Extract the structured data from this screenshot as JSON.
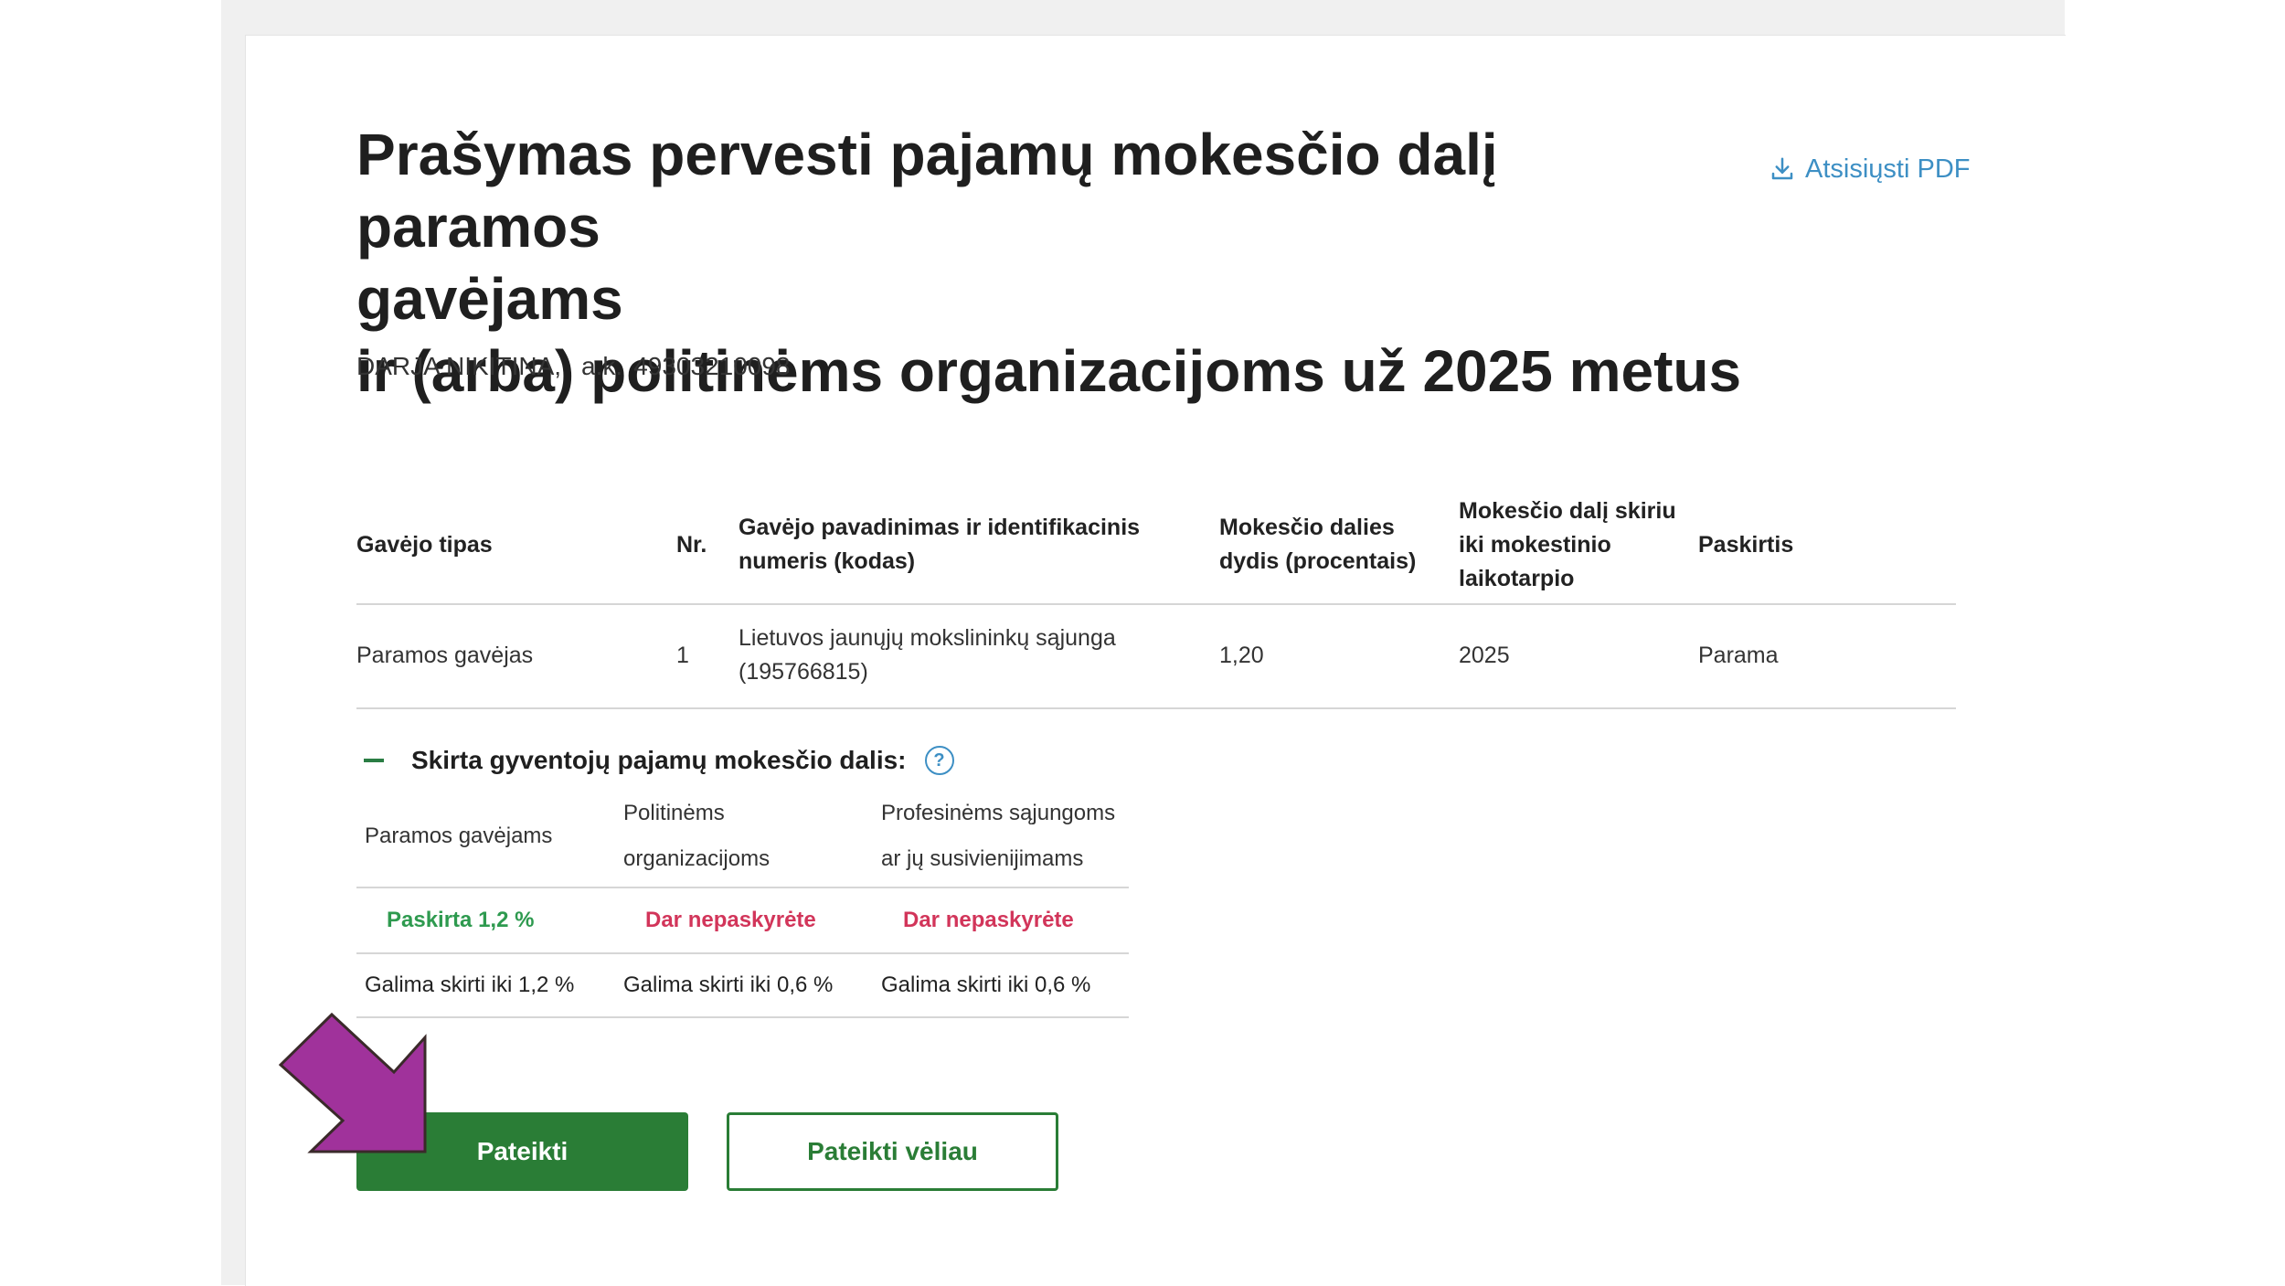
{
  "header": {
    "title_line1": "Prašymas pervesti pajamų mokesčio dalį paramos",
    "title_line2": "gavėjams",
    "title_line3": "ir (arba) politinėms organizacijoms už 2025 metus",
    "pdf_label": "Atsisiųsti PDF",
    "pdf_icon": "download-icon",
    "person_name": "DARJA NIKITINA,",
    "person_code_label": "a.k.",
    "person_code": "49303210098"
  },
  "table": {
    "columns": [
      "Gavėjo tipas",
      "Nr.",
      "Gavėjo pavadinimas ir identifikacinis numeris (kodas)",
      "Mokesčio dalies dydis (procentais)",
      "Mokesčio dalį skiriu iki mokestinio laikotarpio",
      "Paskirtis"
    ],
    "rows": [
      [
        "Paramos gavėjas",
        "1",
        "Lietuvos jaunųjų mokslininkų sąjunga (195766815)",
        "1,20",
        "2025",
        "Parama"
      ]
    ]
  },
  "summary": {
    "toggle_icon": "minus-icon",
    "title": "Skirta gyventojų pajamų mokesčio dalis:",
    "help_icon": "question-icon",
    "columns": [
      "Paramos gavėjams",
      "Politinėms organizacijoms",
      "Profesinėms sąjungoms ar jų susivienijimams"
    ],
    "status": [
      "Paskirta 1,2 %",
      "Dar nepaskyrėte",
      "Dar nepaskyrėte"
    ],
    "limits": [
      "Galima skirti iki 1,2 %",
      "Galima skirti iki 0,6 %",
      "Galima skirti iki 0,6 %"
    ]
  },
  "buttons": {
    "submit": "Pateikti",
    "later": "Pateikti vėliau"
  },
  "colors": {
    "primary_green": "#2a7d36",
    "success_green": "#2e9a4f",
    "alert_red": "#d2355a",
    "link_blue": "#3d8fc4",
    "annotation_arrow": "#a0329b"
  }
}
